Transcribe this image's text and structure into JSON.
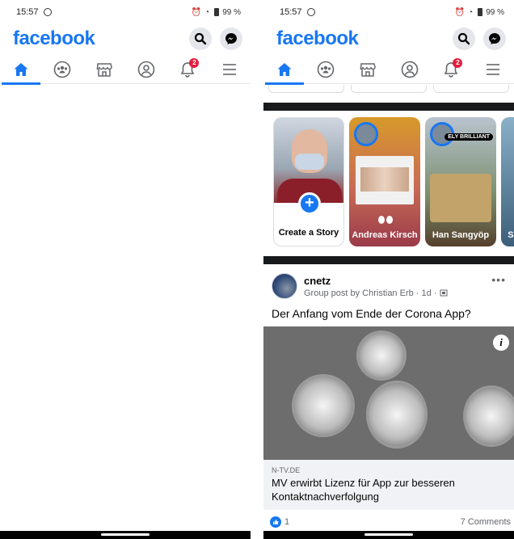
{
  "status": {
    "time": "15:57",
    "battery": "99 %"
  },
  "brand": "facebook",
  "nav": {
    "notifications_badge": "2"
  },
  "stories": [
    {
      "label": "Create a Story"
    },
    {
      "label": "Andreas Kirsch"
    },
    {
      "label": "Han Sangyöp",
      "tag": "ELY BRILLIANT"
    },
    {
      "label": "Sy"
    }
  ],
  "post": {
    "author": "cnetz",
    "subtitle": "Group post by Christian Erb · 1d ·",
    "text": "Der Anfang vom Ende der Corona App?",
    "link_domain": "N-TV.DE",
    "link_title": "MV erwirbt Lizenz für App zur besseren Kontaktnachverfolgung",
    "likes": "1",
    "comments": "7 Comments"
  },
  "colors": {
    "brand": "#1877f2",
    "badge": "#e41e3f"
  },
  "icons": [
    "search-icon",
    "messenger-icon",
    "home-icon",
    "groups-icon",
    "marketplace-icon",
    "profile-icon",
    "bell-icon",
    "menu-icon",
    "plus-icon",
    "info-icon",
    "like-icon"
  ]
}
